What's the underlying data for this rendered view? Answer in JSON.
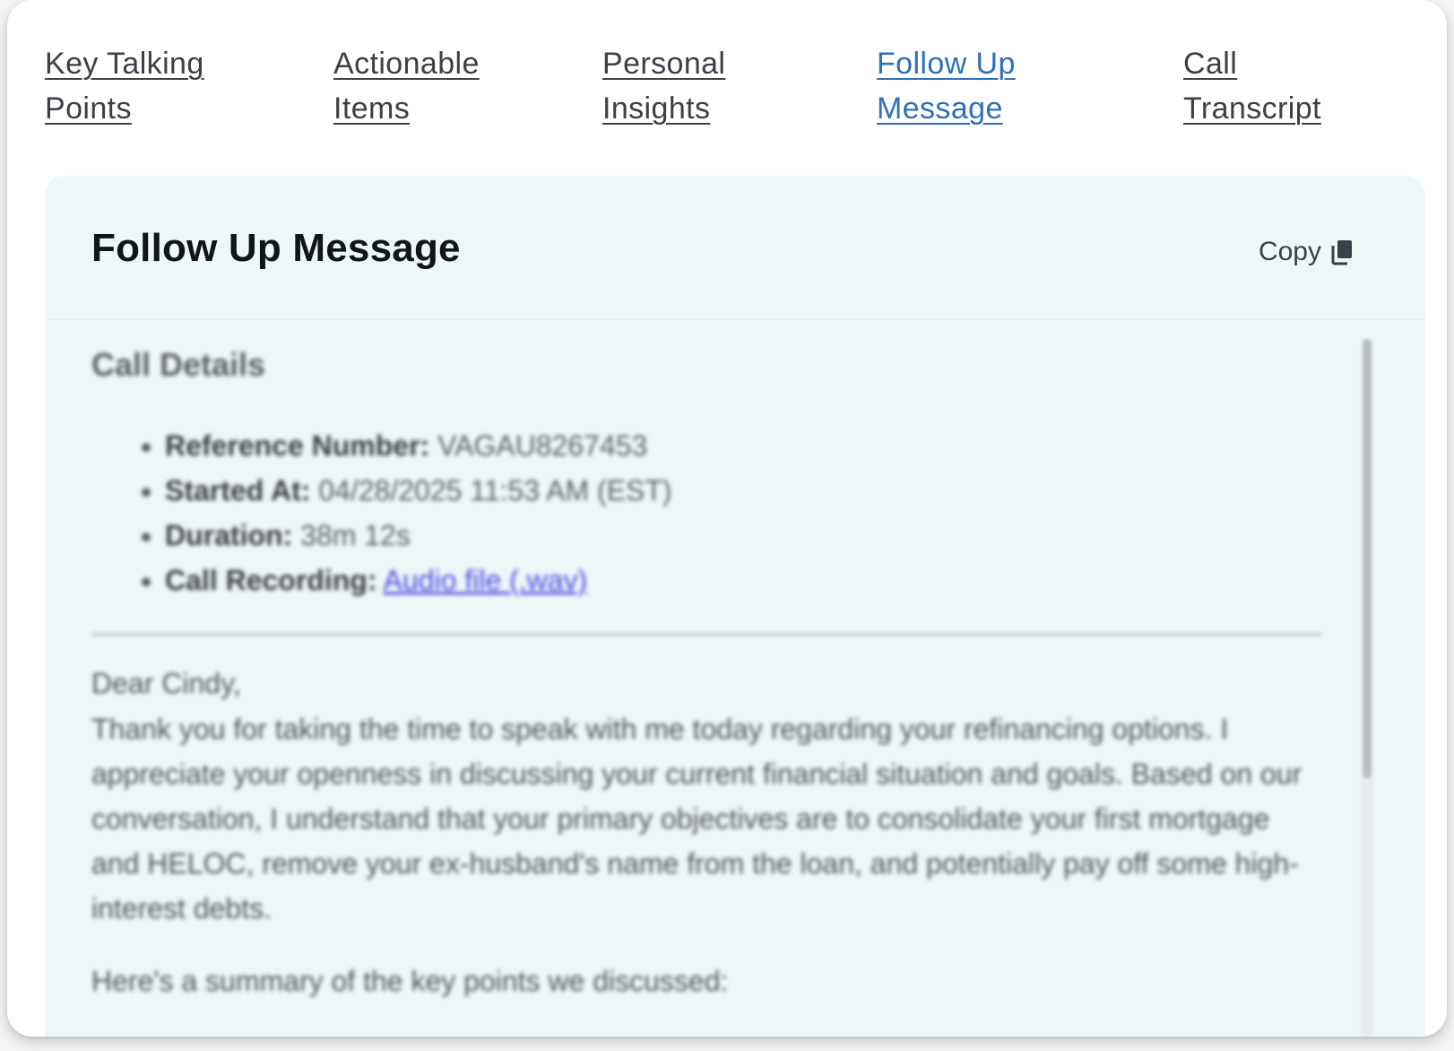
{
  "tabs": [
    {
      "line1": "Key Talking",
      "line2": "Points",
      "active": false
    },
    {
      "line1": "Actionable",
      "line2": "Items",
      "active": false
    },
    {
      "line1": "Personal",
      "line2": "Insights",
      "active": false
    },
    {
      "line1": "Follow Up",
      "line2": "Message",
      "active": true
    },
    {
      "line1": "Call",
      "line2": "Transcript",
      "active": false
    }
  ],
  "panel": {
    "title": "Follow Up Message",
    "copy_label": "Copy",
    "copy_icon": "copy-icon"
  },
  "call_details": {
    "heading": "Call Details",
    "reference_label": "Reference Number:",
    "reference_value": "VAGAU8267453",
    "started_label": "Started At:",
    "started_value": "04/28/2025 11:53 AM (EST)",
    "duration_label": "Duration:",
    "duration_value": "38m 12s",
    "recording_label": "Call Recording:",
    "recording_link": "Audio file (.wav)"
  },
  "message": {
    "greeting": "Dear Cindy,",
    "paragraph": "Thank you for taking the time to speak with me today regarding your refinancing options. I appreciate your openness in discussing your current financial situation and goals. Based on our conversation, I understand that your primary objectives are to consolidate your first mortgage and HELOC, remove your ex-husband's name from the loan, and potentially pay off some high-interest debts.",
    "summary_intro": "Here's a summary of the key points we discussed:"
  },
  "colors": {
    "active_tab": "#2e6fb6",
    "panel_bg": "#eef7f8",
    "link": "#4a45e0"
  }
}
